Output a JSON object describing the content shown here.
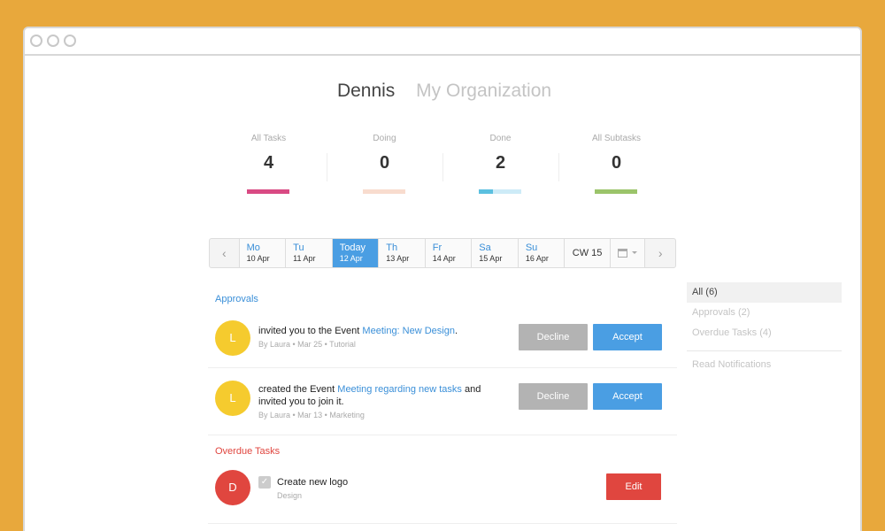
{
  "header": {
    "active_user": "Dennis",
    "other_tab": "My Organization"
  },
  "stats": [
    {
      "label": "All Tasks",
      "value": "4",
      "bar_color": "#D94A83"
    },
    {
      "label": "Doing",
      "value": "0",
      "bar_color": "#F8DCCE"
    },
    {
      "label": "Done",
      "value": "2",
      "bar_color": "#5BC0E0",
      "bar_color_secondary": "#CDEBF7",
      "progress": 0.34
    },
    {
      "label": "All Subtasks",
      "value": "0",
      "bar_color": "#9BC46A"
    }
  ],
  "calendar": {
    "prev_icon": "chevron-left-icon",
    "next_icon": "chevron-right-icon",
    "days": [
      {
        "name": "Mo",
        "date": "10 Apr"
      },
      {
        "name": "Tu",
        "date": "11 Apr"
      },
      {
        "name": "Today",
        "date": "12 Apr"
      },
      {
        "name": "Th",
        "date": "13 Apr"
      },
      {
        "name": "Fr",
        "date": "14 Apr"
      },
      {
        "name": "Sa",
        "date": "15 Apr"
      },
      {
        "name": "Su",
        "date": "16 Apr"
      }
    ],
    "week": "CW 15",
    "picker_icon": "calendar-icon"
  },
  "approvals": {
    "title": "Approvals",
    "items": [
      {
        "avatar": "L",
        "avatar_color": "#F5CB2E",
        "text_before": "invited you to the Event ",
        "link": "Meeting: New Design",
        "text_after": ".",
        "text_line2": "",
        "meta": "By Laura • Mar 25 • Tutorial",
        "decline": "Decline",
        "accept": "Accept"
      },
      {
        "avatar": "L",
        "avatar_color": "#F5CB2E",
        "text_before": "created the Event ",
        "link": "Meeting regarding new tasks",
        "text_after": " and",
        "text_line2": "invited you to join it.",
        "meta": "By Laura • Mar 13 • Marketing",
        "decline": "Decline",
        "accept": "Accept"
      }
    ]
  },
  "overdue": {
    "title": "Overdue Tasks",
    "items": [
      {
        "avatar": "D",
        "avatar_color": "#E0463F",
        "task": "Create new logo",
        "meta": "Design",
        "edit": "Edit",
        "check": "✓"
      }
    ]
  },
  "sidebar": {
    "items": [
      "All (6)",
      "Approvals (2)",
      "Overdue Tasks (4)"
    ],
    "footer": "Read Notifications"
  }
}
